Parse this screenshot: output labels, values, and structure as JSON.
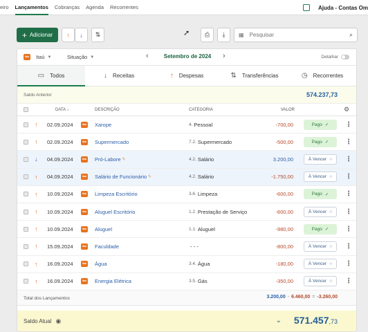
{
  "topnav": {
    "tabs": [
      "eiro",
      "Lançamentos",
      "Cobranças",
      "Agenda",
      "Recorrentes"
    ],
    "active_index": 1,
    "help": "Ajuda - Contas Om"
  },
  "toolbar": {
    "add_label": "Adicionar",
    "search_placeholder": "Pesquisar"
  },
  "filters": {
    "bank": "Itaú",
    "bank_logo": "itaú",
    "status": "Situação",
    "month": "Setembro de 2024",
    "detalhar": "Detalhar"
  },
  "tabs": [
    {
      "label": "Todos",
      "icon": "calendar-icon"
    },
    {
      "label": "Receitas",
      "icon": "arrow-down-icon"
    },
    {
      "label": "Despesas",
      "icon": "arrow-up-icon"
    },
    {
      "label": "Transferências",
      "icon": "transfer-icon"
    },
    {
      "label": "Recorrentes",
      "icon": "clock-icon"
    }
  ],
  "saldo_anterior": {
    "label": "Saldo Anterior",
    "value": "574.237,73"
  },
  "table": {
    "headers": {
      "data": "Data",
      "descricao": "Descrição",
      "categoria": "Categoria",
      "valor": "Valor"
    },
    "rows": [
      {
        "type": "despesa",
        "date": "02.09.2024",
        "desc": "Xarope",
        "cat_num": "4.",
        "cat": "Pessoal",
        "value": "-700,00",
        "status": "Pago",
        "highlight": false,
        "note": false
      },
      {
        "type": "despesa",
        "date": "02.09.2024",
        "desc": "Supermercado",
        "cat_num": "7.2.",
        "cat": "Supermercado",
        "value": "-500,00",
        "status": "Pago",
        "highlight": false,
        "note": false
      },
      {
        "type": "receita",
        "date": "04.09.2024",
        "desc": "Pró-Labore",
        "cat_num": "4.2.",
        "cat": "Salário",
        "value": "3.200,00",
        "status": "À Vencer",
        "highlight": true,
        "note": true
      },
      {
        "type": "despesa",
        "date": "04.09.2024",
        "desc": "Salário de Funcionário",
        "cat_num": "4.2.",
        "cat": "Salário",
        "value": "-1.750,00",
        "status": "À Vencer",
        "highlight": true,
        "note": true
      },
      {
        "type": "despesa",
        "date": "10.09.2024",
        "desc": "Limpeza Escritório",
        "cat_num": "3.6.",
        "cat": "Limpeza",
        "value": "-600,00",
        "status": "Pago",
        "highlight": false,
        "note": false
      },
      {
        "type": "despesa",
        "date": "10.09.2024",
        "desc": "Aluguel Escritório",
        "cat_num": "1.2.",
        "cat": "Prestação de Serviço",
        "value": "-600,00",
        "status": "À Vencer",
        "highlight": false,
        "note": false
      },
      {
        "type": "despesa",
        "date": "10.09.2024",
        "desc": "Aluguel",
        "cat_num": "1.1.",
        "cat": "Aluguel",
        "value": "-980,00",
        "status": "Pago",
        "highlight": false,
        "note": false
      },
      {
        "type": "despesa",
        "date": "15.09.2024",
        "desc": "Faculdade",
        "cat_num": "",
        "cat": "- - -",
        "value": "-800,00",
        "status": "À Vencer",
        "highlight": false,
        "note": false
      },
      {
        "type": "despesa",
        "date": "16.09.2024",
        "desc": "Água",
        "cat_num": "3.4.",
        "cat": "Água",
        "value": "-180,00",
        "status": "À Vencer",
        "highlight": false,
        "note": false
      },
      {
        "type": "despesa",
        "date": "16.09.2024",
        "desc": "Energia Elétrica",
        "cat_num": "3.5.",
        "cat": "Gás",
        "value": "-350,00",
        "status": "À Vencer",
        "highlight": false,
        "note": false
      }
    ]
  },
  "totals": {
    "label": "Total dos Lançamentos",
    "receitas": "3.200,00",
    "despesas": "6.460,00",
    "resultado": "-3.260,00",
    "minus": "-",
    "equals": "="
  },
  "saldo_atual": {
    "label": "Saldo Atual",
    "value_int": "571.457",
    "value_cents": ",73"
  }
}
